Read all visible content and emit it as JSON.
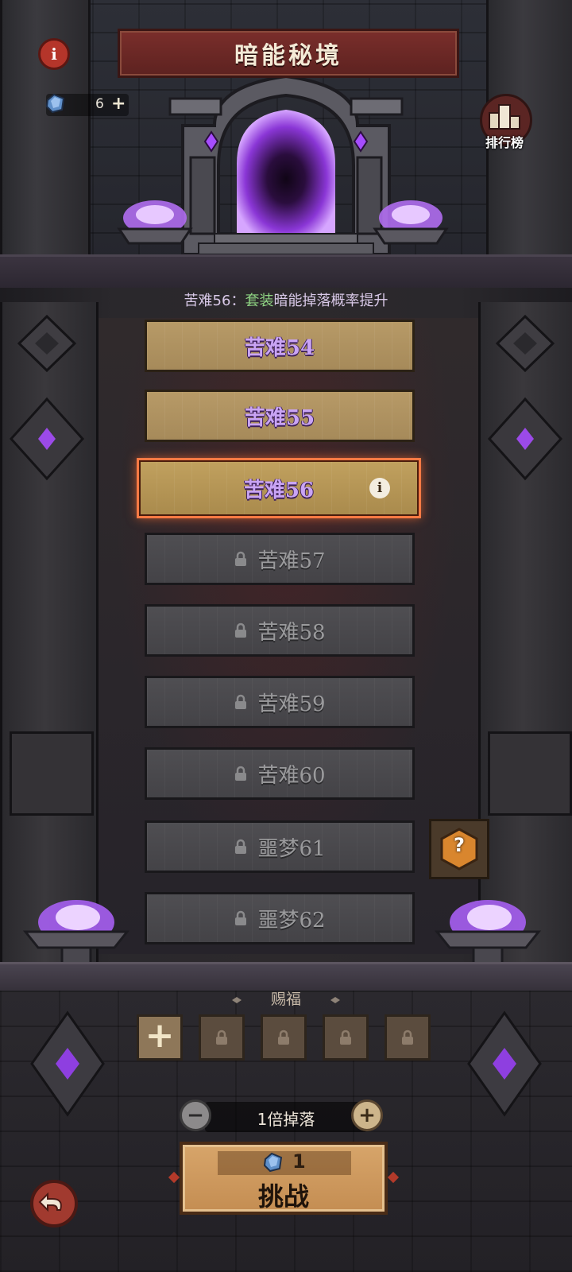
{
  "header": {
    "title": "暗能秘境",
    "info_label": "i"
  },
  "currency": {
    "amount": "6",
    "add_label": "+"
  },
  "leaderboard": {
    "label": "排行榜"
  },
  "hint": {
    "prefix": "苦难56：",
    "highlight": "套装",
    "suffix": "暗能掉落概率提升"
  },
  "levels": [
    {
      "label": "苦难54",
      "state": "unlocked"
    },
    {
      "label": "苦难55",
      "state": "unlocked"
    },
    {
      "label": "苦难56",
      "state": "selected"
    },
    {
      "label": "苦难57",
      "state": "locked"
    },
    {
      "label": "苦难58",
      "state": "locked"
    },
    {
      "label": "苦难59",
      "state": "locked"
    },
    {
      "label": "苦难60",
      "state": "locked"
    },
    {
      "label": "噩梦61",
      "state": "locked"
    },
    {
      "label": "噩梦62",
      "state": "locked"
    }
  ],
  "selected_info_label": "i",
  "mystery": {
    "label": "?"
  },
  "blessing": {
    "title": "赐福",
    "add_label": "+",
    "slots": [
      "add",
      "locked",
      "locked",
      "locked",
      "locked"
    ]
  },
  "drop": {
    "minus_label": "−",
    "plus_label": "+",
    "text": "1倍掉落"
  },
  "challenge": {
    "cost": "1",
    "label": "挑战"
  },
  "colors": {
    "accent_purple": "#c9a4f4",
    "highlight_green": "#8fd483",
    "selected_border": "#ff7a44",
    "portal": "#a64dff"
  },
  "icons": [
    "info-icon",
    "gem-icon",
    "leaderboard-icon",
    "portal",
    "lock-icon",
    "question-icon",
    "back-arrow-icon"
  ]
}
